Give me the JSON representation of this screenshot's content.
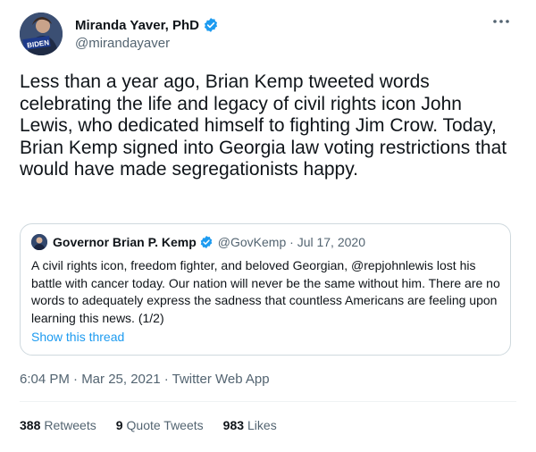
{
  "author": {
    "name": "Miranda Yaver, PhD",
    "handle": "@mirandayaver",
    "avatar_text": "BIDEN"
  },
  "tweet": {
    "text": "Less than a year ago, Brian Kemp tweeted words celebrating the life and legacy of civil rights icon John Lewis, who dedicated himself to fighting Jim Crow. Today, Brian Kemp signed into Georgia law voting restrictions that would have made segregationists happy.",
    "timestamp": "6:04 PM · Mar 25, 2021 · Twitter Web App"
  },
  "quote": {
    "name": "Governor Brian P. Kemp",
    "meta": "@GovKemp · Jul 17, 2020",
    "text": "A civil rights icon, freedom fighter, and beloved Georgian, @repjohnlewis lost his battle with cancer today. Our nation will never be the same without him. There are no words to adequately express the sadness that countless Americans are feeling upon learning this news. (1/2)",
    "show_thread": "Show this thread"
  },
  "stats": {
    "retweets_count": "388",
    "retweets_label": "Retweets",
    "quotes_count": "9",
    "quotes_label": "Quote Tweets",
    "likes_count": "983",
    "likes_label": "Likes"
  },
  "colors": {
    "accent": "#1d9bf0",
    "secondary_text": "#536471",
    "border": "#cfd9de"
  },
  "icons": [
    "verified-badge-icon",
    "more-options-icon"
  ]
}
